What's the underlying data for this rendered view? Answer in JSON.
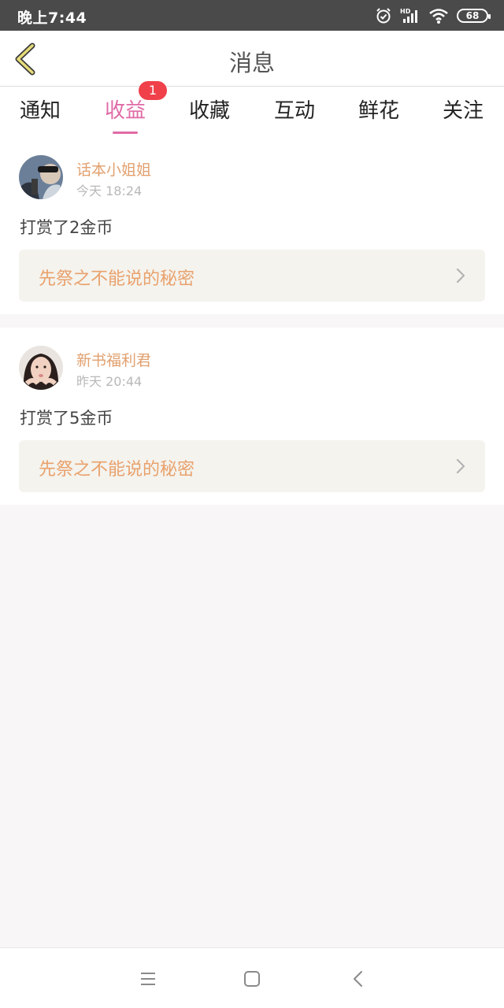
{
  "status_bar": {
    "time": "晚上7:44",
    "battery": "68",
    "icons": [
      "alarm-icon",
      "hd-signal-icon",
      "wifi-icon",
      "battery-icon"
    ]
  },
  "header": {
    "title": "消息",
    "back_icon": "chevron-left-icon"
  },
  "tabs": [
    {
      "label": "通知"
    },
    {
      "label": "收益",
      "active": true,
      "badge": "1"
    },
    {
      "label": "收藏"
    },
    {
      "label": "互动"
    },
    {
      "label": "鲜花"
    },
    {
      "label": "关注"
    }
  ],
  "messages": [
    {
      "sender": "话本小姐姐",
      "time": "今天 18:24",
      "text": "打赏了2金币",
      "book": "先祭之不能说的秘密"
    },
    {
      "sender": "新书福利君",
      "time": "昨天 20:44",
      "text": "打赏了5金币",
      "book": "先祭之不能说的秘密"
    }
  ],
  "nav_bar": {
    "icons": [
      "menu-icon",
      "home-icon",
      "back-icon"
    ]
  },
  "colors": {
    "accent": "#e06aa6",
    "badge": "#f0404a",
    "sender": "#e2a06e",
    "book_title": "#e9a16c",
    "book_bg": "#f4f3ee"
  }
}
